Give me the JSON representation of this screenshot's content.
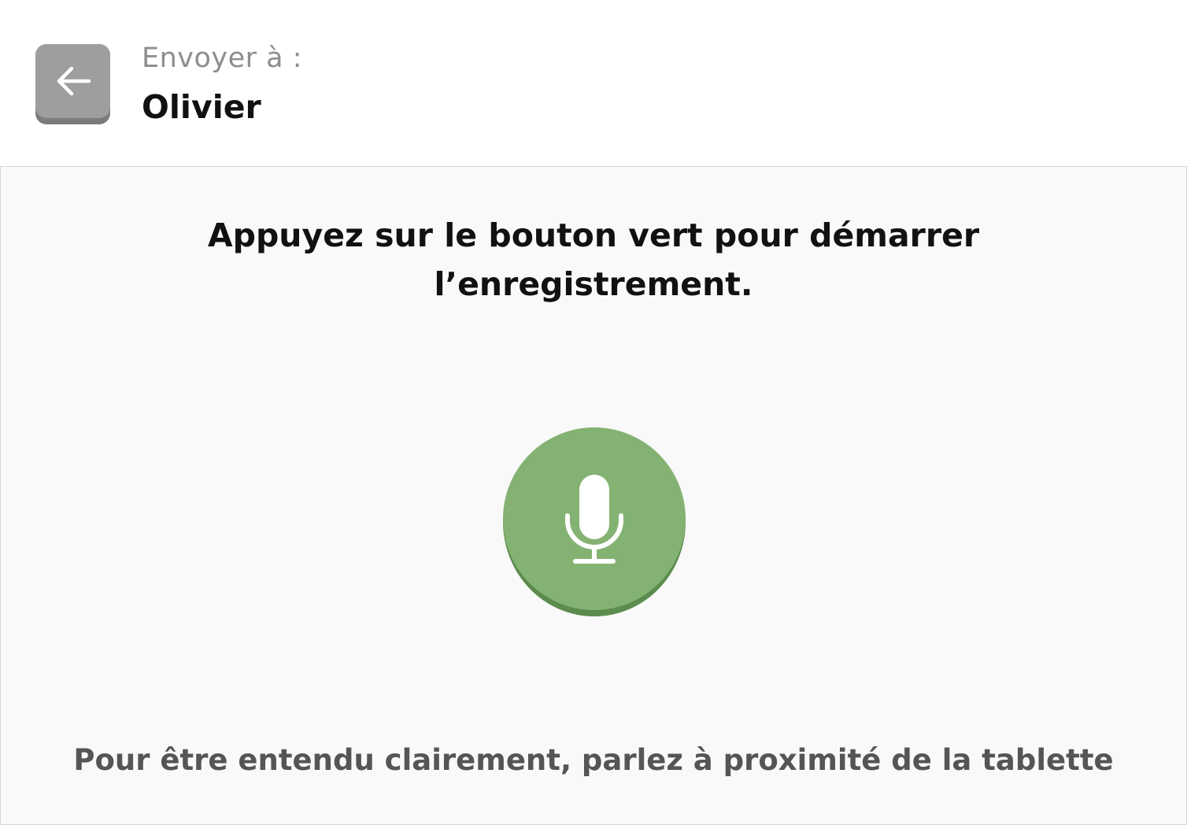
{
  "header": {
    "back_icon": "arrow-left-icon",
    "recipient_label": "Envoyer à :",
    "recipient_name": "Olivier"
  },
  "main": {
    "instruction": "Appuyez sur le bouton vert pour démarrer l’enregistrement.",
    "record_icon": "microphone-icon",
    "hint": "Pour être entendu clairement, parlez à proximité de la tablette"
  },
  "colors": {
    "back_button": "#9e9e9e",
    "record_button": "#84b272",
    "record_button_shadow": "#5b8c4e",
    "background": "#f9f9f9"
  }
}
